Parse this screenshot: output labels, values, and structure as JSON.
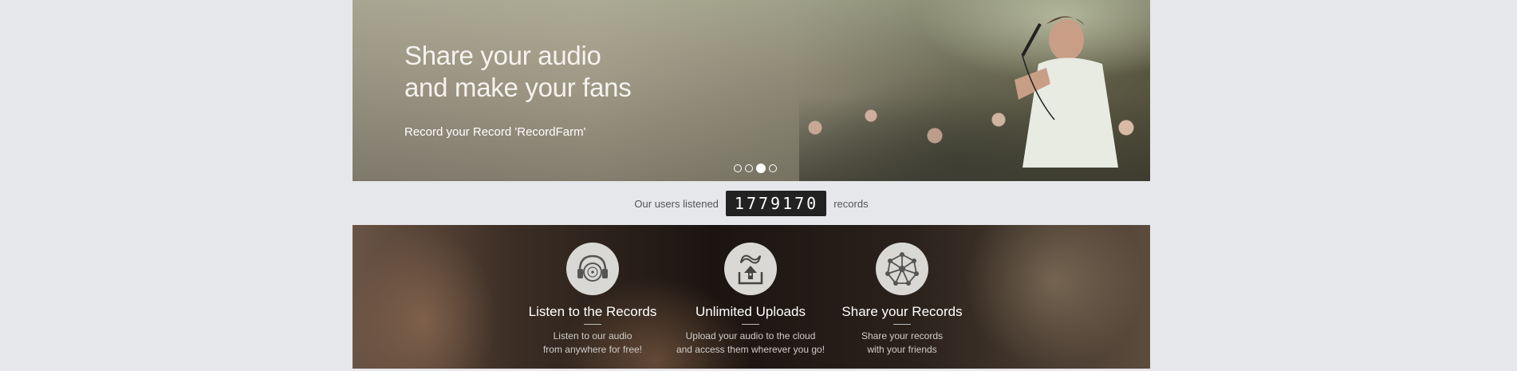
{
  "hero": {
    "title_line1": "Share your audio",
    "title_line2": "and make your fans",
    "subtitle": "Record your Record 'RecordFarm'",
    "slides": [
      {
        "active": false
      },
      {
        "active": false
      },
      {
        "active": true
      },
      {
        "active": false
      }
    ]
  },
  "counter": {
    "prefix": "Our users listened",
    "value": "1779170",
    "suffix": "records"
  },
  "features": [
    {
      "icon": "headphones-record-icon",
      "title": "Listen to the Records",
      "desc_line1": "Listen to our audio",
      "desc_line2": "from anywhere for free!"
    },
    {
      "icon": "cloud-upload-icon",
      "title": "Unlimited Uploads",
      "desc_line1": "Upload your audio to the cloud",
      "desc_line2": "and access them wherever you go!"
    },
    {
      "icon": "network-share-icon",
      "title": "Share your Records",
      "desc_line1": "Share your records",
      "desc_line2": "with your friends"
    }
  ],
  "colors": {
    "page_bg": "#e6e7eb",
    "counter_bg": "#222222",
    "icon_circle": "#d9d8d5"
  }
}
